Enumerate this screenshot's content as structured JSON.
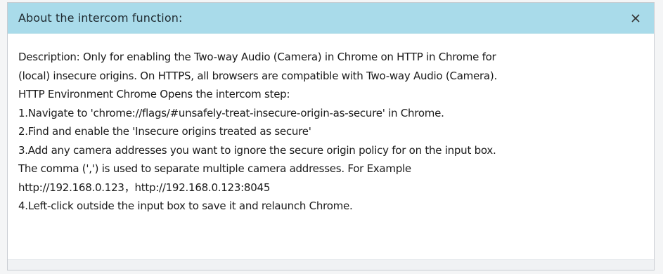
{
  "dialog": {
    "title": "About the intercom function:",
    "close_icon": "close-icon",
    "lines": [
      "Description: Only for enabling the Two-way Audio (Camera) in Chrome on HTTP in Chrome for",
      "(local) insecure origins. On HTTPS, all browsers are compatible with Two-way Audio (Camera).",
      "HTTP Environment Chrome Opens the intercom step:",
      "1.Navigate to 'chrome://flags/#unsafely-treat-insecure-origin-as-secure' in Chrome.",
      "2.Find and enable the 'Insecure origins treated as secure'",
      "3.Add any camera addresses you want to ignore the secure origin policy for on the input box.",
      "The comma (',') is used to separate multiple camera addresses. For Example",
      "http://192.168.0.123，http://192.168.0.123:8045",
      "4.Left-click outside the input box to save it and relaunch Chrome."
    ]
  },
  "colors": {
    "header_bg": "#a9dbea",
    "text": "#1a1a1a"
  }
}
